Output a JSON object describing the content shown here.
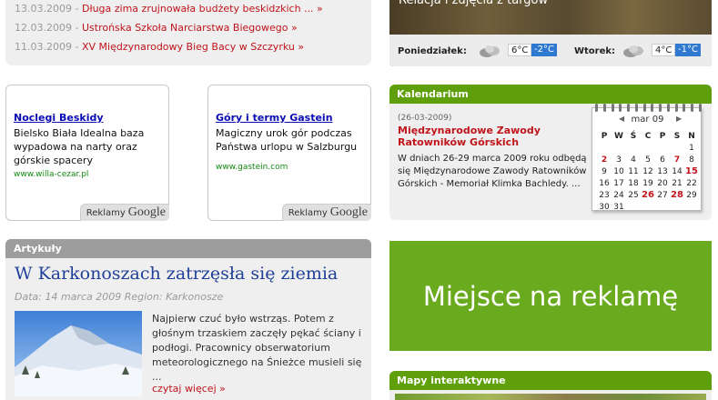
{
  "news": [
    {
      "date": "13.03.2009",
      "sep": "-",
      "title": "Długa zima zrujnowała budżety beskidzkich ... »"
    },
    {
      "date": "12.03.2009",
      "sep": "-",
      "title": "Ustrońska Szkoła Narciarstwa Biegowego »"
    },
    {
      "date": "11.03.2009",
      "sep": "-",
      "title": "XV Międzynarodowy Bieg Bacy w Szczyrku »"
    }
  ],
  "ads": [
    {
      "title": "Noclegi Beskidy",
      "body": "Bielsko Biała Idealna baza wypadowa na narty oraz górskie spacery",
      "url": "www.willa-cezar.pl",
      "tag_text": "Reklamy",
      "tag_logo": "Google"
    },
    {
      "title": "Góry i termy Gastein",
      "body": "Magiczny urok gór podczas Państwa urlopu w Salzburgu",
      "url": "www.gastein.com",
      "tag_text": "Reklamy",
      "tag_logo": "Google"
    }
  ],
  "weather": {
    "caption": "Relacja i zdjęcia z targów",
    "days": [
      {
        "name": "Poniedziałek:",
        "icon": "cloud-icon",
        "max": "6°C",
        "min": "-2°C"
      },
      {
        "name": "Wtorek:",
        "icon": "cloud-icon",
        "max": "4°C",
        "min": "-1°C"
      }
    ]
  },
  "kalendarium": {
    "header": "Kalendarium",
    "date": "(26-03-2009)",
    "title": "Międzynarodowe Zawody Ratowników Górskich",
    "text": "W dniach 26-29 marca 2009 roku odbędą się Międzynarodowe Zawody Ratowników Górskich - Memoriał Klimka Bachledy. ...",
    "calendar": {
      "month": "mar 09",
      "weekdays": [
        "P",
        "W",
        "Ś",
        "C",
        "P",
        "S",
        "N"
      ],
      "days": [
        {
          "d": "",
          "s": ""
        },
        {
          "d": "",
          "s": ""
        },
        {
          "d": "",
          "s": ""
        },
        {
          "d": "",
          "s": ""
        },
        {
          "d": "",
          "s": ""
        },
        {
          "d": "",
          "s": ""
        },
        {
          "d": "1",
          "s": ""
        },
        {
          "d": "2",
          "s": "red"
        },
        {
          "d": "3",
          "s": ""
        },
        {
          "d": "4",
          "s": ""
        },
        {
          "d": "5",
          "s": ""
        },
        {
          "d": "6",
          "s": ""
        },
        {
          "d": "7",
          "s": "red"
        },
        {
          "d": "8",
          "s": ""
        },
        {
          "d": "9",
          "s": ""
        },
        {
          "d": "10",
          "s": ""
        },
        {
          "d": "11",
          "s": ""
        },
        {
          "d": "12",
          "s": ""
        },
        {
          "d": "13",
          "s": ""
        },
        {
          "d": "14",
          "s": ""
        },
        {
          "d": "15",
          "s": "big"
        },
        {
          "d": "16",
          "s": ""
        },
        {
          "d": "17",
          "s": ""
        },
        {
          "d": "18",
          "s": ""
        },
        {
          "d": "19",
          "s": ""
        },
        {
          "d": "20",
          "s": ""
        },
        {
          "d": "21",
          "s": ""
        },
        {
          "d": "22",
          "s": ""
        },
        {
          "d": "23",
          "s": ""
        },
        {
          "d": "24",
          "s": ""
        },
        {
          "d": "25",
          "s": ""
        },
        {
          "d": "26",
          "s": "big"
        },
        {
          "d": "27",
          "s": ""
        },
        {
          "d": "28",
          "s": "big"
        },
        {
          "d": "29",
          "s": ""
        },
        {
          "d": "30",
          "s": ""
        },
        {
          "d": "31",
          "s": ""
        }
      ]
    }
  },
  "articles": {
    "header": "Artykuły",
    "title": "W Karkonoszach zatrzęsła się ziemia",
    "meta": "Data: 14 marca 2009 Region: Karkonosze",
    "body": "Najpierw czuć było wstrząs. Potem z głośnym trzaskiem zaczęły pękać ściany i podłogi. Pracownicy obserwatorium meteorologicznego na Śnieżce musieli się ...",
    "more": "czytaj więcej »"
  },
  "promo": {
    "text": "Miejsce na reklamę"
  },
  "maps": {
    "header": "Mapy interaktywne"
  }
}
